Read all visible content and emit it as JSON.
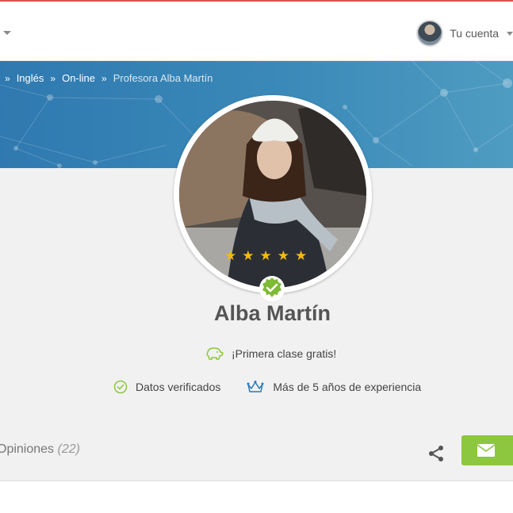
{
  "header": {
    "account_label": "Tu cuenta",
    "icons": [
      "chevron-down-icon",
      "avatar",
      "chevron-down-icon"
    ]
  },
  "breadcrumb": {
    "items": [
      "Inglés",
      "On-line"
    ],
    "separator": "»",
    "current": "Profesora Alba Martín"
  },
  "profile": {
    "name": "Alba Martín",
    "rating_stars": 5,
    "promo": "¡Primera clase gratis!",
    "verified_label": "Datos verificados",
    "experience_label": "Más de 5 años de experiencia"
  },
  "actions": {
    "opinions_label": "Opiniones",
    "opinions_count": "(22)"
  },
  "colors": {
    "accent_green": "#8dc63f",
    "banner_blue": "#3a89b8",
    "star_yellow": "#f5b914",
    "text_gray": "#555555"
  }
}
